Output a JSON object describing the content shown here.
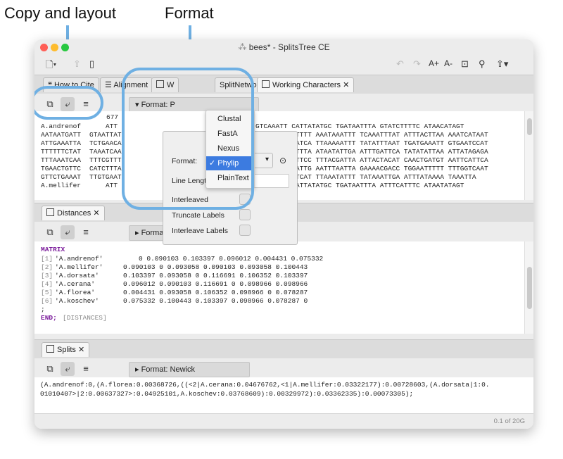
{
  "annotations": {
    "copy_layout": "Copy and layout",
    "format": "Format"
  },
  "window": {
    "title": "bees* - SplitsTree CE",
    "status": "0.1 of 20G"
  },
  "toolbar": {
    "font_bigger": "A+",
    "font_smaller": "A-"
  },
  "top_tabs": [
    "How to Cite",
    "Alignment",
    "W",
    "SplitNetwork",
    "Working Characters"
  ],
  "characters_panel": {
    "format_label": "Format: P",
    "header_count": "677",
    "lines": [
      [
        "A.andrenof",
        "ATT",
        "GTCAAATT CATTATATGC TGATAATTTA GTATCTTTTC ATAACATAGT"
      ],
      [
        "AATAATGATT",
        "GTAATTAT",
        "TTG ATTTATTTTT AAATAAATTT TCAAATTTAT ATTTACTTAA AAATCATAAT"
      ],
      [
        "ATTGAAATTA",
        "TCTGAACA",
        "TTG TTTTCCATCA TTAAAAATTT TATATTTAAT TGATGAAATT GTGAATCCAT"
      ],
      [
        "TTTTTTCTAT",
        "TAAATCAA",
        "TAT CCTGAATTTA ATAATATTGA ATTTGATTCA TATATATTAA ATTATAGAGA"
      ],
      [
        "TTTAAATCAA",
        "TTTCGTTT",
        "CTA TAAAAATTCC TTTACGATTA ATTACTACAT CAACTGATGT AATTCATTCA"
      ],
      [
        "TGAACTGTTC",
        "CATCTTTA",
        "AAT TAATCAATTG AATTTAATTA GAAAACGACC TGGAATTTTT TTTGGTCAAT"
      ],
      [
        "GTTCTGAAAT",
        "TTGTGAAT",
        "GAA TCAACATCAT TTAAATATTT TATAAATTGA ATTTATAAAA TAAATTA"
      ],
      [
        "A.mellifer",
        "ATT",
        "ATCAAATT CATTATATGC TGATAATTTA ATTTCATTTC ATAATATAGT"
      ]
    ]
  },
  "format_popup": {
    "format_label": "Format:",
    "line_length_label": "Line Lengt",
    "interleaved_label": "Interleaved",
    "truncate_labels_label": "Truncate Labels",
    "interleave_labels_label": "Interleave Labels"
  },
  "format_menu": {
    "options": [
      "Clustal",
      "FastA",
      "Nexus",
      "Phylip",
      "PlainText"
    ],
    "selected": "Phylip",
    "checkmark": "✓"
  },
  "distances_panel": {
    "tab": "Distances",
    "format_label": "Format: Nexus",
    "matrix_keyword": "MATRIX",
    "rows": [
      {
        "idx": "[1]",
        "name": "'A.andrenof'",
        "values": "0 0.090103 0.103397 0.096012 0.004431 0.075332"
      },
      {
        "idx": "[2]",
        "name": "'A.mellifer'",
        "values": "0.090103 0 0.093058 0.090103 0.093058 0.100443"
      },
      {
        "idx": "[3]",
        "name": "'A.dorsata'",
        "values": "0.103397 0.093058 0 0.116691 0.106352 0.103397"
      },
      {
        "idx": "[4]",
        "name": "'A.cerana'",
        "values": "0.096012 0.090103 0.116691 0 0.098966 0.098966"
      },
      {
        "idx": "[5]",
        "name": "'A.florea'",
        "values": "0.004431 0.093058 0.106352 0.098966 0 0.078287"
      },
      {
        "idx": "[6]",
        "name": "'A.koschev'",
        "values": "0.075332 0.100443 0.103397 0.098966 0.078287 0"
      }
    ],
    "semicolon": ";",
    "end_keyword": "END;",
    "end_comment": "[DISTANCES]"
  },
  "splits_panel": {
    "tab": "Splits",
    "format_label": "Format: Newick",
    "line1": "(A.andrenof:0,(A.florea:0.00368726,((<2|A.cerana:0.04676762,<1|A.mellifer:0.03322177):0.00728603,(A.dorsata|1:0.",
    "line2": "01010407>|2:0.00637327>:0.04925101,A.koschev:0.03768609):0.00329972):0.03362335):0.00073305);"
  },
  "colors": {
    "ring": "#6fb0e3",
    "menu_highlight": "#3c7be0",
    "keyword": "#7a1a9a"
  }
}
